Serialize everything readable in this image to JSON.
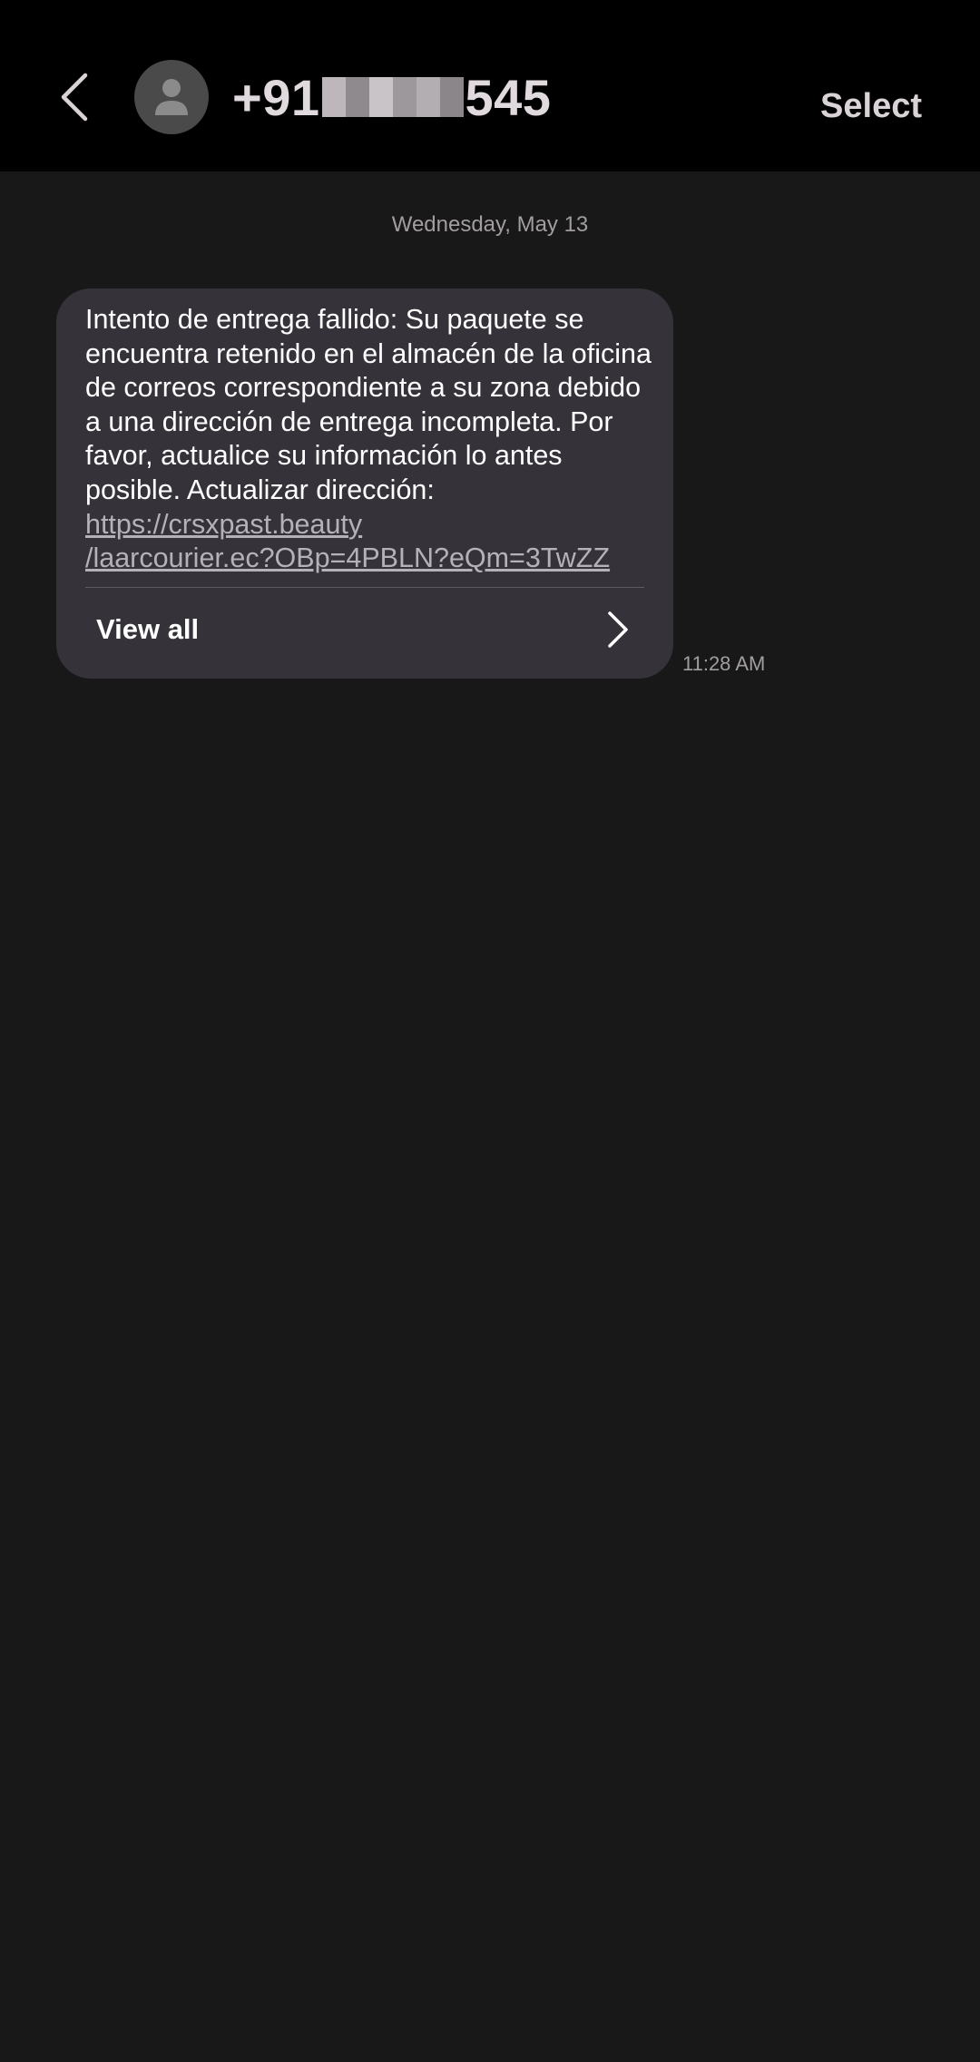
{
  "header": {
    "contact_prefix": "+91",
    "contact_suffix": "545",
    "select_label": "Select"
  },
  "conversation": {
    "date": "Wednesday, May 13",
    "message": {
      "text": "Intento de entrega fallido: Su paquete se encuentra retenido en el almacén de la oficina de correos correspondiente a su zona debido a una dirección de entrega incompleta. Por favor, actualice su información lo antes posible. Actualizar dirección: ",
      "link_part1": "https://crsxpast.beauty",
      "link_part2": "/laarcourier.ec?OBp=4PBLN?eQm=3TwZZ",
      "view_all_label": "View all",
      "time": "11:28 AM"
    }
  },
  "colors": {
    "header_bg": "#000000",
    "page_bg": "#181818",
    "bubble_bg": "#35323a",
    "accent_text": "#e0d9dd"
  },
  "icons": {
    "back": "chevron-left-icon",
    "avatar": "person-icon",
    "view_all": "chevron-right-icon"
  }
}
